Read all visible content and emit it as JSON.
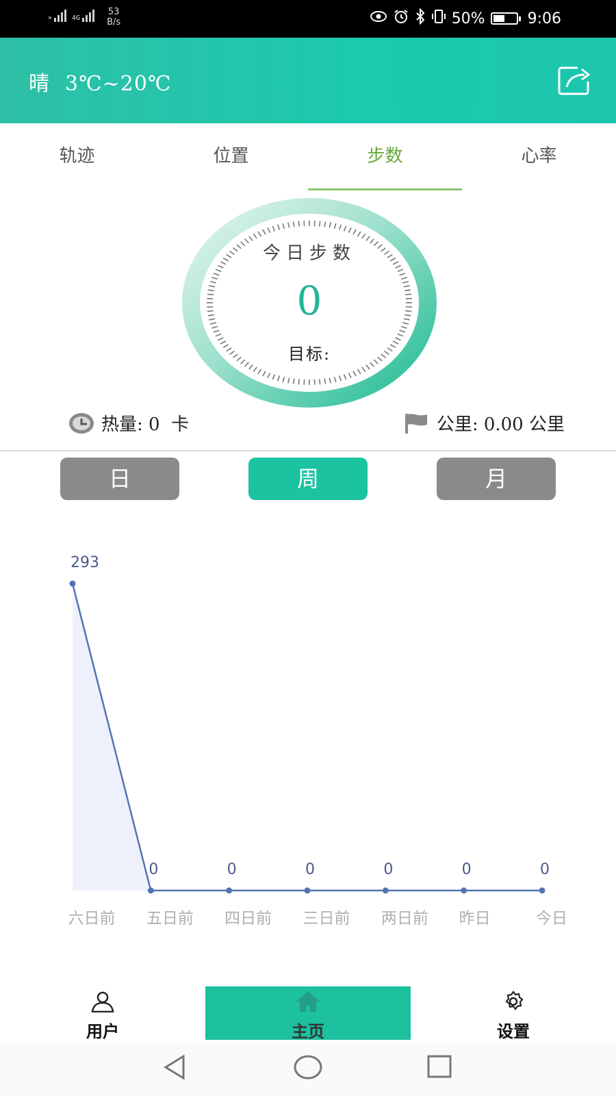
{
  "status_bar": {
    "sim1": "×",
    "sim2": "4G",
    "net_speed_value": "53",
    "net_speed_unit": "B/s",
    "battery_percent": "50%",
    "battery_level": 0.5,
    "time": "9:06",
    "icons": [
      "eye-icon",
      "alarm-icon",
      "bluetooth-icon",
      "vibrate-icon"
    ]
  },
  "header": {
    "weather_condition": "晴",
    "temperature_range": "3℃~20℃",
    "share_icon": "share-icon",
    "background_color": "#1bc9ae"
  },
  "tabs": [
    {
      "label": "轨迹",
      "active": false
    },
    {
      "label": "位置",
      "active": false
    },
    {
      "label": "步数",
      "active": true
    },
    {
      "label": "心率",
      "active": false
    }
  ],
  "dial": {
    "title": "今日步数",
    "value": "0",
    "goal_label": "目标:"
  },
  "stats": {
    "calories": "热量: 0  卡",
    "distance": "公里: 0.00 公里",
    "calories_icon": "clock-icon",
    "distance_icon": "flag-icon"
  },
  "period_buttons": {
    "day": "日",
    "week": "周",
    "month": "月",
    "active": "周"
  },
  "chart_data": {
    "type": "line",
    "x": [
      "六日前",
      "五日前",
      "四日前",
      "三日前",
      "两日前",
      "昨日",
      "今日"
    ],
    "values": [
      293,
      0,
      0,
      0,
      0,
      0,
      0
    ],
    "data_labels": [
      "293",
      "0",
      "0",
      "0",
      "0",
      "0",
      "0"
    ],
    "title": "",
    "xlabel": "",
    "ylabel": "",
    "ylim": [
      0,
      293
    ],
    "grid": false,
    "line_color": "#5573b4",
    "fill_color": "#eef1fb"
  },
  "bottom_nav": {
    "user": "用户",
    "home": "主页",
    "settings": "设置",
    "active": "主页",
    "active_color": "#1cc09e"
  },
  "system_nav": {
    "back_icon": "back-triangle-icon",
    "home_icon": "home-circle-icon",
    "recents_icon": "recents-square-icon"
  }
}
